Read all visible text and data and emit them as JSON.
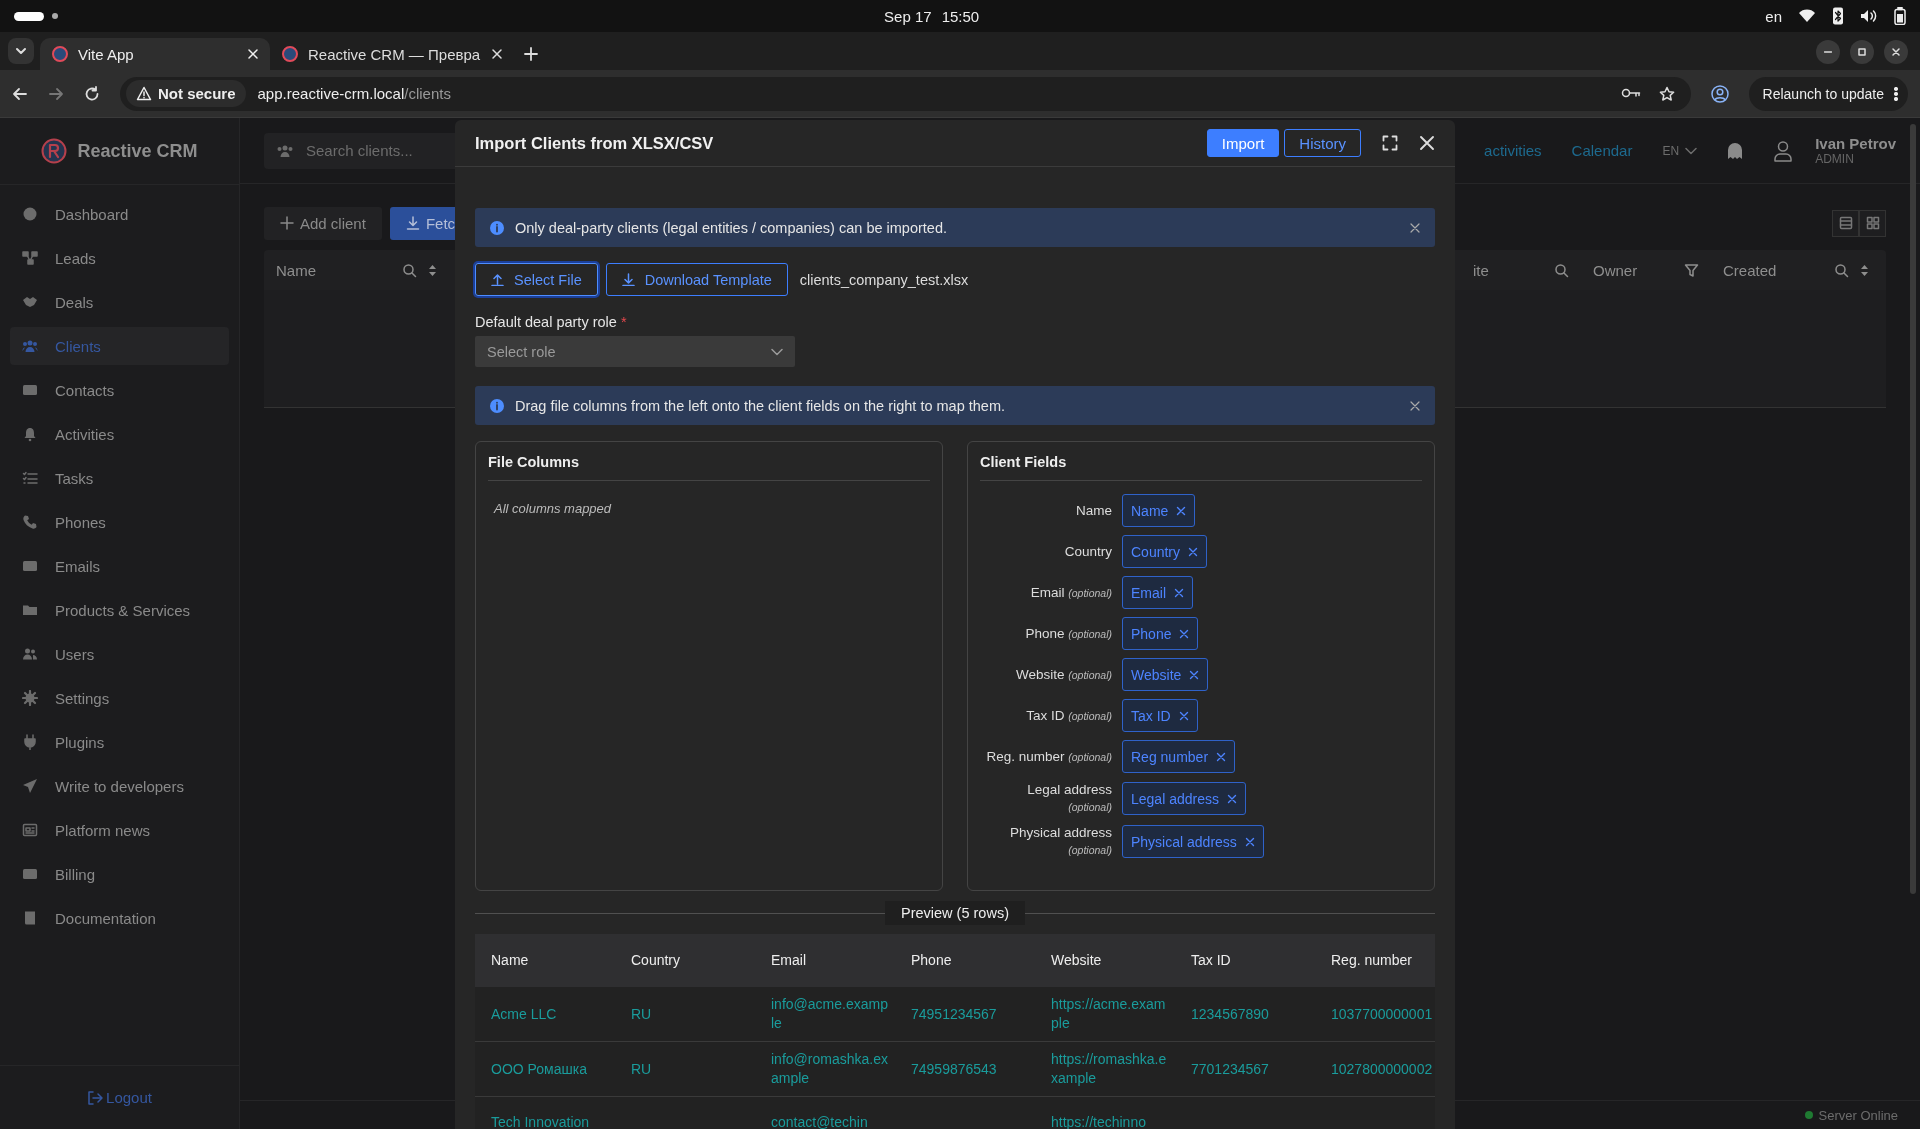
{
  "system_bar": {
    "date": "Sep 17",
    "time": "15:50",
    "keyboard_layout": "en"
  },
  "browser": {
    "tabs": [
      {
        "title": "Vite App",
        "selected": true
      },
      {
        "title": "Reactive CRM — Превра",
        "selected": false
      }
    ],
    "security_label": "Not secure",
    "url_host": "app.reactive-crm.local",
    "url_path": "/clients",
    "update_button": "Relaunch to update"
  },
  "app": {
    "brand": "Reactive CRM",
    "nav": [
      {
        "label": "Dashboard",
        "selected": false
      },
      {
        "label": "Leads",
        "selected": false
      },
      {
        "label": "Deals",
        "selected": false
      },
      {
        "label": "Clients",
        "selected": true
      },
      {
        "label": "Contacts",
        "selected": false
      },
      {
        "label": "Activities",
        "selected": false
      },
      {
        "label": "Tasks",
        "selected": false
      },
      {
        "label": "Phones",
        "selected": false
      },
      {
        "label": "Emails",
        "selected": false
      },
      {
        "label": "Products & Services",
        "selected": false
      },
      {
        "label": "Users",
        "selected": false
      },
      {
        "label": "Settings",
        "selected": false
      },
      {
        "label": "Plugins",
        "selected": false
      },
      {
        "label": "Write to developers",
        "selected": false
      },
      {
        "label": "Platform news",
        "selected": false
      },
      {
        "label": "Billing",
        "selected": false
      },
      {
        "label": "Documentation",
        "selected": false
      }
    ],
    "logout": "Logout",
    "search": {
      "placeholder": "Search clients..."
    },
    "header_links": [
      "activities",
      "Calendar"
    ],
    "language": "EN",
    "user": {
      "name": "Ivan Petrov",
      "role": "ADMIN"
    },
    "toolbar_buttons": [
      {
        "label": "Add client",
        "kind": "plain"
      },
      {
        "label": "Fetc",
        "kind": "primary"
      }
    ],
    "table_columns": [
      "Name",
      "ite",
      "Owner",
      "Created"
    ],
    "server_status": "Server Online"
  },
  "modal": {
    "title": "Import Clients from XLSX/CSV",
    "header_buttons": [
      {
        "label": "Import",
        "kind": "primary"
      },
      {
        "label": "History",
        "kind": "outline"
      }
    ],
    "alerts": [
      {
        "text": "Only deal-party clients (legal entities / companies) can be imported."
      },
      {
        "text": "Drag file columns from the left onto the client fields on the right to map them."
      }
    ],
    "file_buttons": [
      {
        "label": "Select File",
        "focused": true
      },
      {
        "label": "Download Template",
        "focused": false
      }
    ],
    "file_name": "clients_company_test.xlsx",
    "role_field": {
      "label": "Default deal party role",
      "required_mark": "*",
      "placeholder": "Select role"
    },
    "file_columns": {
      "title": "File Columns",
      "empty_text": "All columns mapped"
    },
    "client_fields": {
      "title": "Client Fields",
      "fields": [
        {
          "label": "Name",
          "chip": "Name"
        },
        {
          "label": "Country",
          "chip": "Country"
        },
        {
          "label": "Email",
          "hint": "(optional)",
          "chip": "Email"
        },
        {
          "label": "Phone",
          "hint": "(optional)",
          "chip": "Phone"
        },
        {
          "label": "Website",
          "hint": "(optional)",
          "chip": "Website"
        },
        {
          "label": "Tax ID",
          "hint": "(optional)",
          "chip": "Tax ID"
        },
        {
          "label": "Reg. number",
          "hint": "(optional)",
          "chip": "Reg number"
        },
        {
          "label": "Legal address",
          "hint": "(optional)",
          "chip": "Legal address"
        },
        {
          "label": "Physical address",
          "hint": "(optional)",
          "chip": "Physical address"
        }
      ]
    },
    "preview": {
      "label": "Preview (5 rows)",
      "columns": [
        "Name",
        "Country",
        "Email",
        "Phone",
        "Website",
        "Tax ID",
        "Reg. number"
      ],
      "rows": [
        [
          "Acme LLC",
          "RU",
          "info@acme.example",
          "74951234567",
          "https://acme.example",
          "1234567890",
          "1037700000001"
        ],
        [
          "ООО Ромашка",
          "RU",
          "info@romashka.example",
          "74959876543",
          "https://romashka.example",
          "7701234567",
          "1027800000002"
        ],
        [
          "Tech Innovation",
          null,
          "contact@techin",
          null,
          "https://techinno",
          null,
          null
        ]
      ]
    }
  }
}
